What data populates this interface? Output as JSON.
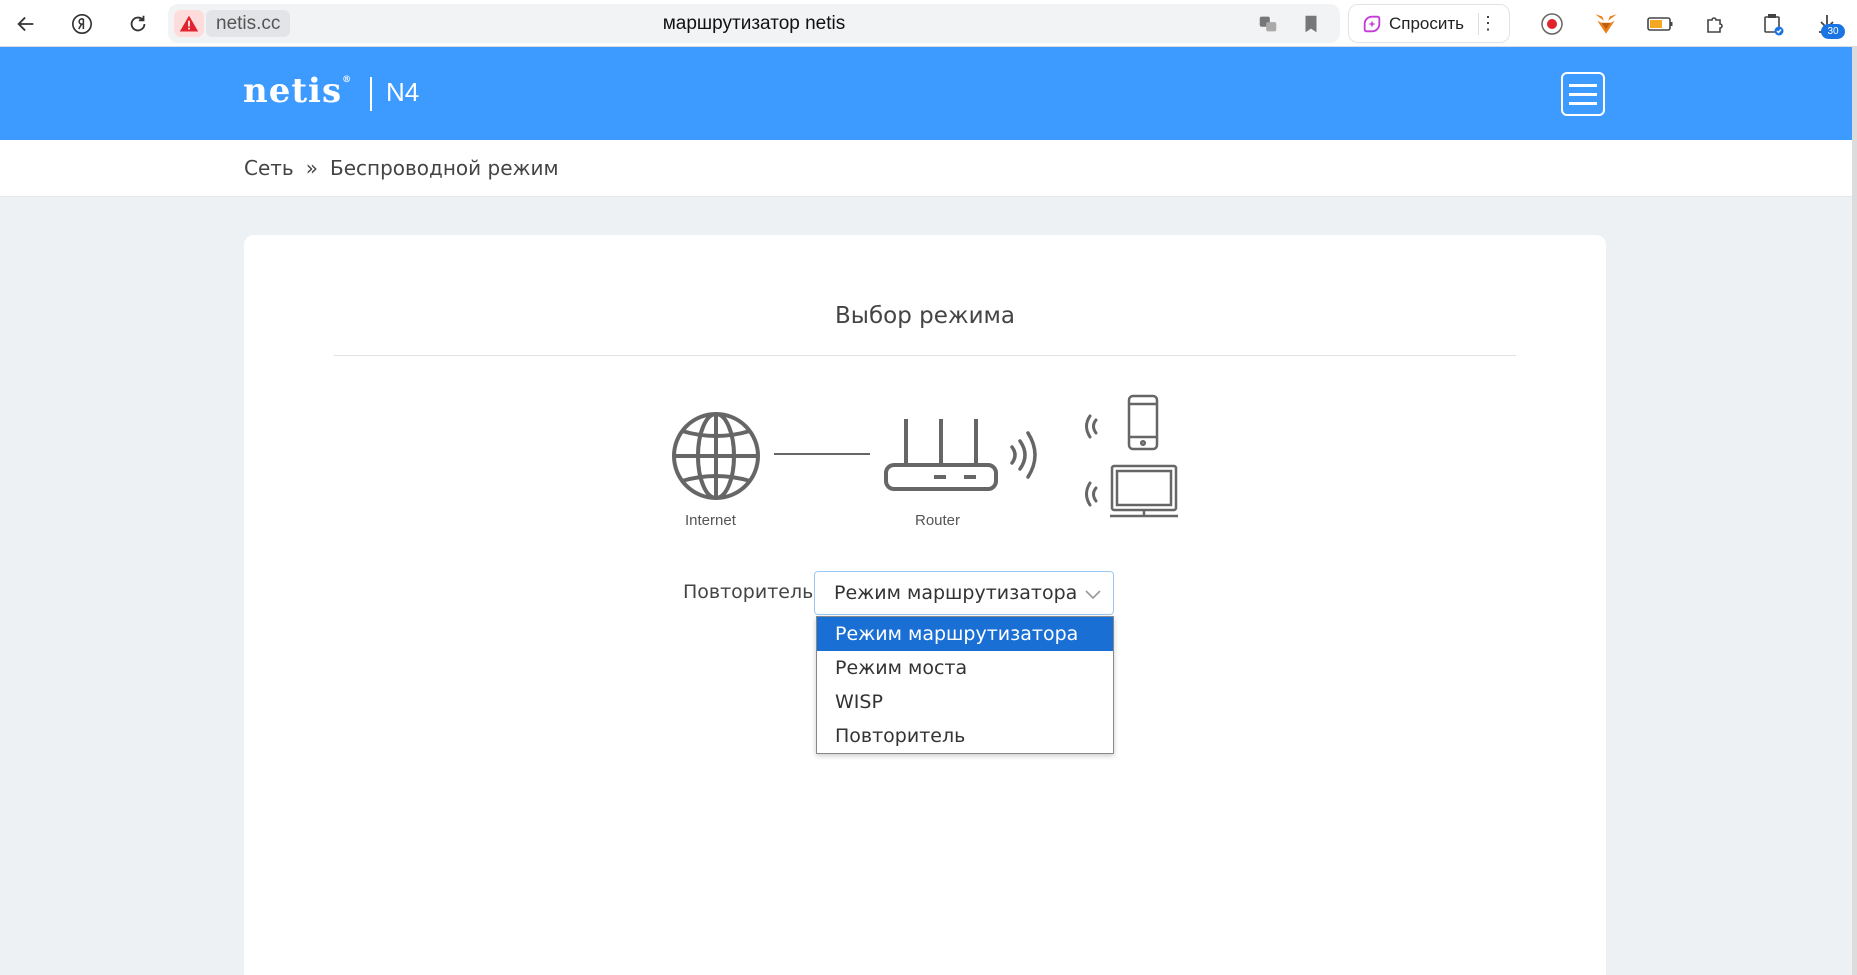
{
  "browser": {
    "host": "netis.cc",
    "title": "маршрутизатор netis",
    "ask_label": "Спросить",
    "more_label": "⋮",
    "downloads_count": "30"
  },
  "app": {
    "brand": "netis",
    "brand_mark": "®",
    "model": "N4",
    "accent_color": "#3d9bff"
  },
  "breadcrumb": {
    "items": [
      "Сеть",
      "Беспроводной режим"
    ],
    "separator": "»"
  },
  "card": {
    "title": "Выбор режима",
    "diagram": {
      "internet_label": "Internet",
      "router_label": "Router"
    },
    "mode_label": "Повторитель",
    "select": {
      "value": "Режим маршрутизатора",
      "options": [
        "Режим маршрутизатора",
        "Режим моста",
        "WISP",
        "Повторитель"
      ],
      "highlighted_index": 0
    }
  }
}
